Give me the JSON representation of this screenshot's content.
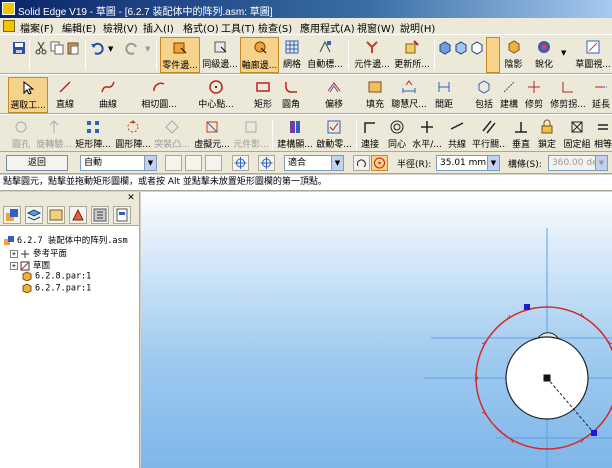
{
  "window": {
    "title": "Solid Edge V19 - 草圖 - [6.2.7 装配体中的阵列.asm: 草圖]"
  },
  "menu": [
    "檔案(F)",
    "編輯(E)",
    "檢視(V)",
    "插入(I)",
    "格式(O)",
    "工具(T)",
    "檢查(S)",
    "應用程式(A)",
    "視窗(W)",
    "說明(H)"
  ],
  "toolbar1": {
    "part_edges": "零件邊...",
    "similar_edges": "同級邊...",
    "axis_edges": "軸廊邊...",
    "grid": "網格",
    "auto_mark": "自動標...",
    "element_edges": "元件邊...",
    "update_all": "更新所...",
    "shading": "陰影",
    "sharpen": "銳化",
    "sketch_view": "草圖視..."
  },
  "toolbar2": {
    "select": "選取工...",
    "line": "直線",
    "curve": "曲線",
    "tangent_arc": "相切圓...",
    "center_point": "中心點...",
    "rectangle": "矩形",
    "fillet": "圓角",
    "offset": "偏移",
    "fill": "填充",
    "smart_dim": "聰慧尺...",
    "spacing": "間距",
    "include": "包括",
    "create": "建構",
    "trim": "修剪",
    "trim_corner": "修剪拐...",
    "extend": "延長"
  },
  "toolbar3": {
    "circle_hole": "圓孔",
    "rotate_sketch": "旋轉驗...",
    "rect_pattern": "矩形陣...",
    "circ_pattern": "圓形陣...",
    "boss": "突裝凸...",
    "virtual_element": "虛擬元...",
    "element_shadow": "元件影...",
    "create_drawing": "建構顯...",
    "enable_relations": "啟動零...",
    "connect": "連接",
    "concentric": "同心",
    "horizontal": "水平/...",
    "collinear": "共線",
    "parallel": "平行關...",
    "perpendicular": "垂直",
    "lock": "鎖定",
    "fixed": "固定組",
    "equal": "相等"
  },
  "ribbon": {
    "back": "返回",
    "mode": "自動",
    "fit": "適合",
    "radius_label": "半徑(R):",
    "radius_value": "35.01 mm",
    "angle_label": "構條(S):",
    "angle_value": "360.00 deg"
  },
  "prompt": "點擊圓元，點擊並拖動矩形圖欄，或者按 Alt 並點擊未放置矩形圖欄的第一頂點。",
  "tree": {
    "root": "6.2.7 装配体中的阵列.asm",
    "items": [
      "參考平面",
      "草圖",
      "6.2.8.par:1",
      "6.2.7.par:1"
    ]
  },
  "colors": {
    "accent": "#f7d28a",
    "circle_red": "#d42a2a",
    "selection_blue": "#1a1ae0"
  }
}
